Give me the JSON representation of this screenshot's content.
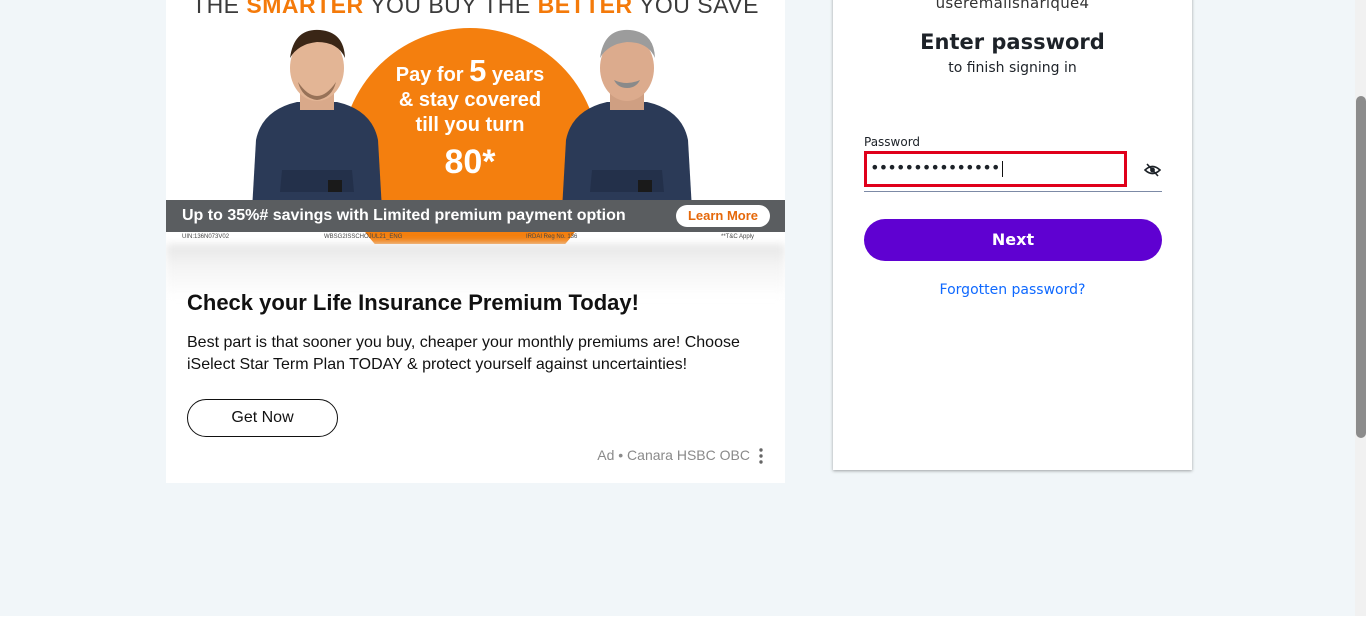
{
  "ad": {
    "banner": {
      "headline_parts": [
        "THE ",
        "SMARTER",
        " YOU BUY THE ",
        "BETTER",
        " YOU SAVE"
      ],
      "offer_line1_prefix": "Pay for ",
      "offer_line1_number": "5",
      "offer_line1_suffix": " years",
      "offer_line2": "& stay covered",
      "offer_line3": "till you turn",
      "offer_line4": "80*",
      "strip_text": "Up to 35%# savings with Limited premium payment option",
      "learn_more": "Learn More",
      "fine_print": [
        "UIN:136N073V02",
        "WBSG2ISSCHOJUL21_ENG",
        "IRDAI Reg No. 136",
        "**T&C Apply"
      ],
      "orange": "#f47f0e"
    },
    "title": "Check your Life Insurance Premium Today!",
    "body": "Best part is that sooner you buy, cheaper your monthly premiums are! Choose iSelect Star Term Plan TODAY & protect yourself against uncertainties!",
    "cta": "Get Now",
    "sponsor": "Ad • Canara HSBC OBC",
    "menu_icon": "kebab-menu-icon"
  },
  "login": {
    "username": "useremailsharique4",
    "title": "Enter password",
    "subtitle": "to finish signing in",
    "password_label": "Password",
    "password_value": "•••••••••••••••",
    "show_password_icon": "eye-slash-icon",
    "next_label": "Next",
    "forgot_label": "Forgotten password?",
    "accent": "#5f01d1",
    "error_outline": "#e0001b"
  }
}
